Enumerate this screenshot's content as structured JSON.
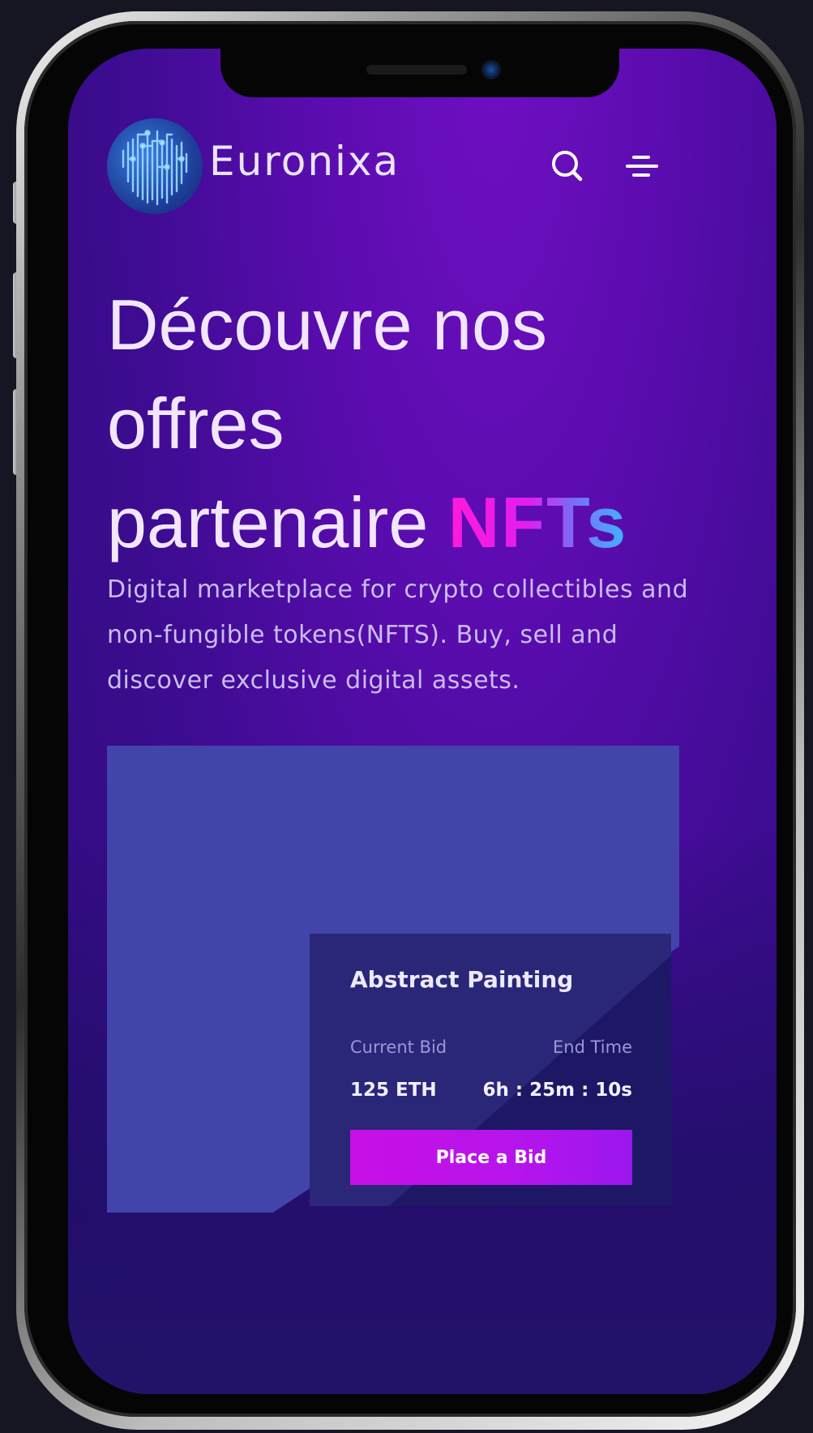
{
  "header": {
    "brand": "Euronixa",
    "search_icon": "search-icon",
    "menu_icon": "menu-icon",
    "logo_icon": "circuit-fingerprint-logo"
  },
  "hero": {
    "title_line1": "Découvre nos",
    "title_line2": "offres",
    "title_line3": "partenaire",
    "title_highlight": "NFTs",
    "description": "Digital marketplace for crypto collectibles and non-fungible tokens(NFTS). Buy, sell and discover exclusive digital assets."
  },
  "auction": {
    "title": "Abstract Painting",
    "current_bid_label": "Current Bid",
    "current_bid_value": "125 ETH",
    "end_time_label": "End Time",
    "end_time_value": "6h : 25m : 10s",
    "button_label": "Place a Bid"
  },
  "colors": {
    "background": "#5a0cae",
    "accent_pink": "#ff1ad9",
    "accent_blue": "#3fb6ff",
    "button": "#c80fe6",
    "art_panel": "#4244a9",
    "card": "#2a2778"
  }
}
